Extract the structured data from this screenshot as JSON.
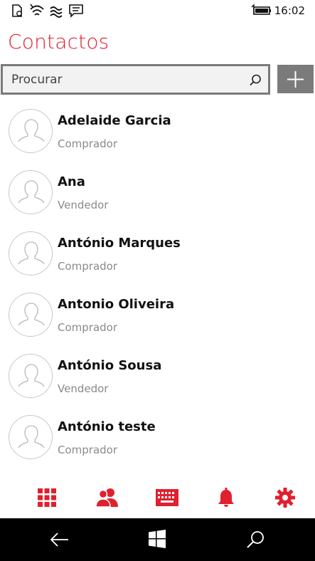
{
  "status_bar": {
    "time": "16:02",
    "icons": [
      "battery-saver-icon",
      "wifi-icon",
      "data-icon",
      "message-icon",
      "battery-icon"
    ]
  },
  "header": {
    "title": "Contactos"
  },
  "search": {
    "placeholder": "Procurar",
    "value": ""
  },
  "toolbar": {
    "add_icon": "plus-icon"
  },
  "contacts": [
    {
      "name": "Adelaide Garcia",
      "role": "Comprador"
    },
    {
      "name": "Ana",
      "role": "Vendedor"
    },
    {
      "name": "António Marques",
      "role": "Comprador"
    },
    {
      "name": "Antonio Oliveira",
      "role": "Comprador"
    },
    {
      "name": "António Sousa",
      "role": "Vendedor"
    },
    {
      "name": "António teste",
      "role": "Comprador"
    }
  ],
  "app_bar": {
    "buttons": [
      "apps-grid-icon",
      "contacts-icon",
      "keyboard-icon",
      "bell-icon",
      "gear-icon"
    ],
    "accent": "#e0202e"
  },
  "nav_bar": {
    "buttons": [
      "back-icon",
      "windows-icon",
      "search-icon"
    ]
  }
}
